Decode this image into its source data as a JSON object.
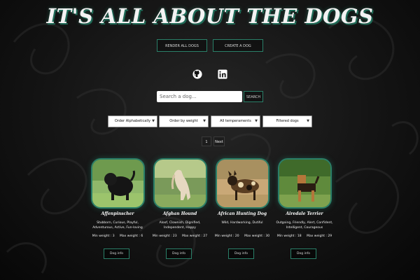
{
  "header": {
    "title": "IT'S ALL ABOUT THE DOGS"
  },
  "nav": {
    "render_all": "RENDER ALL DOGS",
    "create": "CREATE A DOG"
  },
  "social": [
    "github-icon",
    "linkedin-icon"
  ],
  "search": {
    "placeholder": "Search a dog...",
    "button_label": "SEARCH"
  },
  "filters": {
    "order_alpha": "Order Alphabetically",
    "order_weight": "Order by weight",
    "temperaments": "All temperaments",
    "filtered": "Filtered dogs"
  },
  "pagination": {
    "current": "1",
    "next": "Next"
  },
  "dogs": [
    {
      "name": "Affenpinscher",
      "temperament": "Stubborn, Curious, Playful, Adventurous, Active, Fun-loving",
      "min_label": "Min weight : 3",
      "max_label": "Max weight : 6",
      "button": "Dog info"
    },
    {
      "name": "Afghan Hound",
      "temperament": "Aloof, Clownish, Dignified, Independent, Happy",
      "min_label": "Min weight : 23",
      "max_label": "Max weight : 27",
      "button": "Dog info"
    },
    {
      "name": "African Hunting Dog",
      "temperament": "Wild, Hardworking, Dutiful",
      "min_label": "Min weight : 20",
      "max_label": "Max weight : 30",
      "button": "Dog info"
    },
    {
      "name": "Airedale Terrier",
      "temperament": "Outgoing, Friendly, Alert, Confident, Intelligent, Courageous",
      "min_label": "Min weight : 18",
      "max_label": "Max weight : 29",
      "button": "Dog info"
    }
  ],
  "colors": {
    "accent": "#2a7f68",
    "background": "#141414"
  }
}
